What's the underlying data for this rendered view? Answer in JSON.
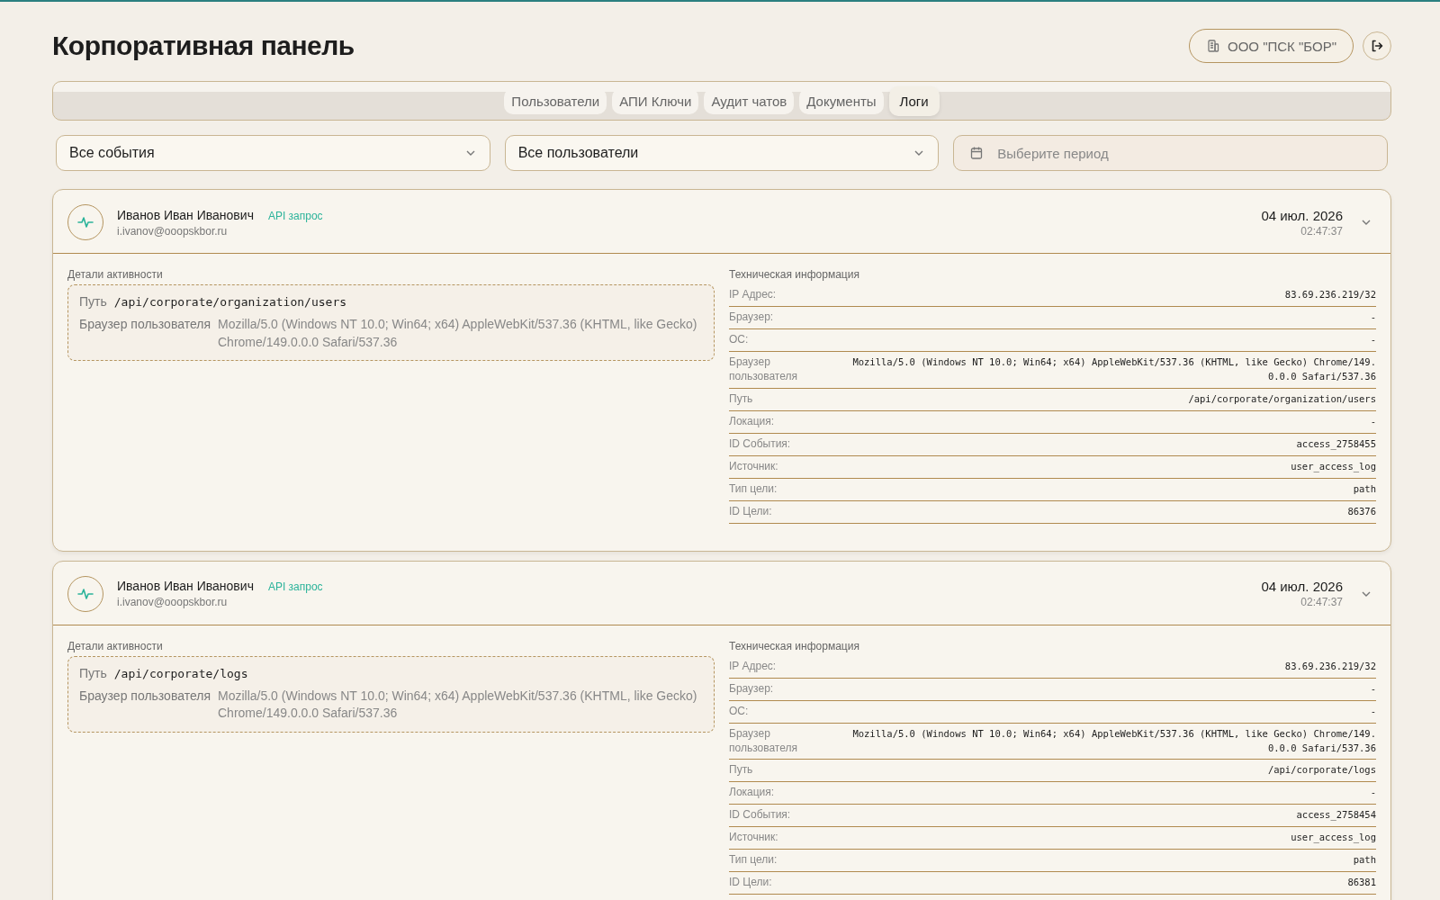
{
  "page_title": "Корпоративная панель",
  "organization": {
    "label": "ООО \"ПСК \"БОР\""
  },
  "tabs": [
    {
      "label": "Пользователи",
      "selected": false
    },
    {
      "label": "АПИ Ключи",
      "selected": false
    },
    {
      "label": "Аудит чатов",
      "selected": false
    },
    {
      "label": "Документы",
      "selected": false
    },
    {
      "label": "Логи",
      "selected": true
    }
  ],
  "filters": {
    "event_select": {
      "value": "Все события"
    },
    "user_select": {
      "value": "Все пользователи"
    },
    "period": {
      "placeholder": "Выберите период"
    }
  },
  "logs": [
    {
      "user": "Иванов Иван Иванович",
      "event_type": "API запрос",
      "email": "i.ivanov@ooopskbor.ru",
      "date": "04 июл. 2026",
      "time": "02:47:37",
      "expanded": true,
      "details_title": "Детали активности",
      "details": [
        {
          "label": "Путь",
          "value": "/api/corporate/organization/users",
          "kind": "code"
        },
        {
          "label": "Браузер пользователя",
          "value": "Mozilla/5.0 (Windows NT 10.0; Win64; x64) AppleWebKit/537.36 (KHTML, like Gecko) Chrome/149.0.0.0 Safari/537.36",
          "kind": "text"
        }
      ],
      "tech_title": "Техническая информация",
      "tech": [
        {
          "label": "IP Адрес:",
          "value": "83.69.236.219/32"
        },
        {
          "label": "Браузер:",
          "value": "-"
        },
        {
          "label": "ОС:",
          "value": "-"
        },
        {
          "label": "Браузер пользователя",
          "value": "Mozilla/5.0 (Windows NT 10.0; Win64; x64) AppleWebKit/537.36 (KHTML, like Gecko) Chrome/149.0.0.0 Safari/537.36"
        },
        {
          "label": "Путь",
          "value": "/api/corporate/organization/users"
        },
        {
          "label": "Локация:",
          "value": "-"
        },
        {
          "label": "ID События:",
          "value": "access_2758455"
        },
        {
          "label": "Источник:",
          "value": "user_access_log"
        },
        {
          "label": "Тип цели:",
          "value": "path"
        },
        {
          "label": "ID Цели:",
          "value": "86376"
        }
      ]
    },
    {
      "user": "Иванов Иван Иванович",
      "event_type": "API запрос",
      "email": "i.ivanov@ooopskbor.ru",
      "date": "04 июл. 2026",
      "time": "02:47:37",
      "expanded": true,
      "details_title": "Детали активности",
      "details": [
        {
          "label": "Путь",
          "value": "/api/corporate/logs",
          "kind": "code"
        },
        {
          "label": "Браузер пользователя",
          "value": "Mozilla/5.0 (Windows NT 10.0; Win64; x64) AppleWebKit/537.36 (KHTML, like Gecko) Chrome/149.0.0.0 Safari/537.36",
          "kind": "text"
        }
      ],
      "tech_title": "Техническая информация",
      "tech": [
        {
          "label": "IP Адрес:",
          "value": "83.69.236.219/32"
        },
        {
          "label": "Браузер:",
          "value": "-"
        },
        {
          "label": "ОС:",
          "value": "-"
        },
        {
          "label": "Браузер пользователя",
          "value": "Mozilla/5.0 (Windows NT 10.0; Win64; x64) AppleWebKit/537.36 (KHTML, like Gecko) Chrome/149.0.0.0 Safari/537.36"
        },
        {
          "label": "Путь",
          "value": "/api/corporate/logs"
        },
        {
          "label": "Локация:",
          "value": "-"
        },
        {
          "label": "ID События:",
          "value": "access_2758454"
        },
        {
          "label": "Источник:",
          "value": "user_access_log"
        },
        {
          "label": "Тип цели:",
          "value": "path"
        },
        {
          "label": "ID Цели:",
          "value": "86381"
        }
      ]
    }
  ]
}
